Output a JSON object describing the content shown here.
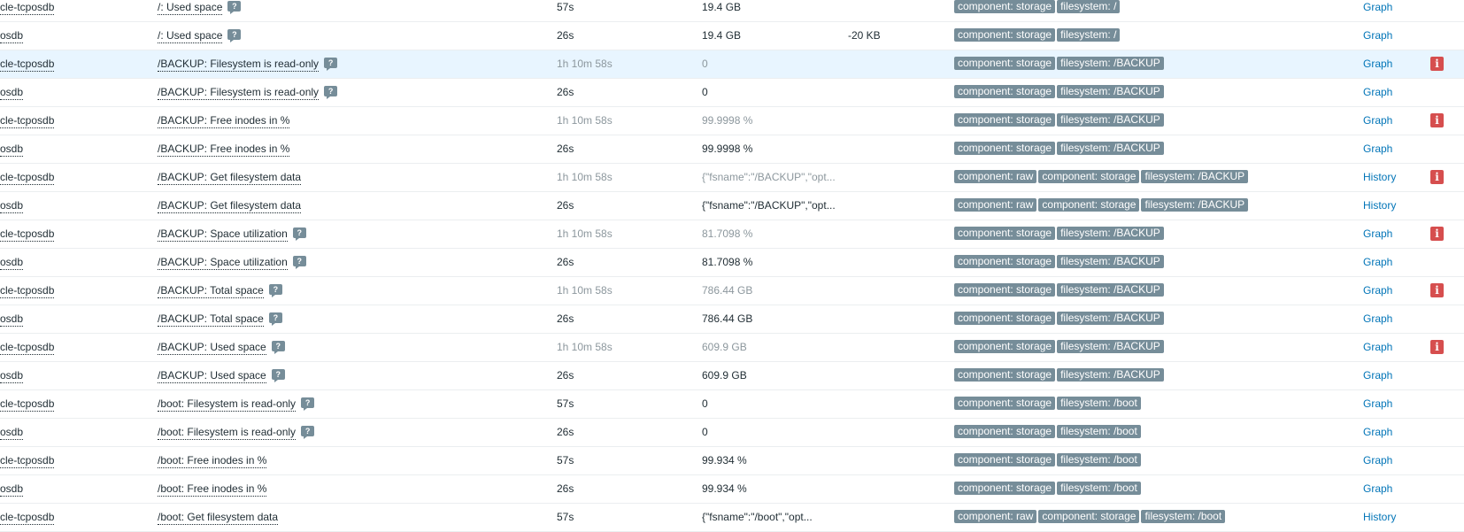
{
  "rows": [
    {
      "host": "cle-tcposdb",
      "name": "/: Used space",
      "hint": true,
      "last": "57s",
      "value": "19.4 GB",
      "change": "",
      "tags": [
        "component: storage",
        "filesystem: /"
      ],
      "link": "Graph",
      "info": false,
      "dim": false,
      "highlight": false
    },
    {
      "host": "osdb",
      "name": "/: Used space",
      "hint": true,
      "last": "26s",
      "value": "19.4 GB",
      "change": "-20 KB",
      "tags": [
        "component: storage",
        "filesystem: /"
      ],
      "link": "Graph",
      "info": false,
      "dim": false,
      "highlight": false
    },
    {
      "host": "cle-tcposdb",
      "name": "/BACKUP: Filesystem is read-only",
      "hint": true,
      "last": "1h 10m 58s",
      "value": "0",
      "change": "",
      "tags": [
        "component: storage",
        "filesystem: /BACKUP"
      ],
      "link": "Graph",
      "info": true,
      "dim": true,
      "highlight": true
    },
    {
      "host": "osdb",
      "name": "/BACKUP: Filesystem is read-only",
      "hint": true,
      "last": "26s",
      "value": "0",
      "change": "",
      "tags": [
        "component: storage",
        "filesystem: /BACKUP"
      ],
      "link": "Graph",
      "info": false,
      "dim": false,
      "highlight": false
    },
    {
      "host": "cle-tcposdb",
      "name": "/BACKUP: Free inodes in %",
      "hint": false,
      "last": "1h 10m 58s",
      "value": "99.9998 %",
      "change": "",
      "tags": [
        "component: storage",
        "filesystem: /BACKUP"
      ],
      "link": "Graph",
      "info": true,
      "dim": true,
      "highlight": false
    },
    {
      "host": "osdb",
      "name": "/BACKUP: Free inodes in %",
      "hint": false,
      "last": "26s",
      "value": "99.9998 %",
      "change": "",
      "tags": [
        "component: storage",
        "filesystem: /BACKUP"
      ],
      "link": "Graph",
      "info": false,
      "dim": false,
      "highlight": false
    },
    {
      "host": "cle-tcposdb",
      "name": "/BACKUP: Get filesystem data",
      "hint": false,
      "last": "1h 10m 58s",
      "value": "{\"fsname\":\"/BACKUP\",\"opt...",
      "change": "",
      "tags": [
        "component: raw",
        "component: storage",
        "filesystem: /BACKUP"
      ],
      "link": "History",
      "info": true,
      "dim": true,
      "highlight": false
    },
    {
      "host": "osdb",
      "name": "/BACKUP: Get filesystem data",
      "hint": false,
      "last": "26s",
      "value": "{\"fsname\":\"/BACKUP\",\"opt...",
      "change": "",
      "tags": [
        "component: raw",
        "component: storage",
        "filesystem: /BACKUP"
      ],
      "link": "History",
      "info": false,
      "dim": false,
      "highlight": false
    },
    {
      "host": "cle-tcposdb",
      "name": "/BACKUP: Space utilization",
      "hint": true,
      "last": "1h 10m 58s",
      "value": "81.7098 %",
      "change": "",
      "tags": [
        "component: storage",
        "filesystem: /BACKUP"
      ],
      "link": "Graph",
      "info": true,
      "dim": true,
      "highlight": false
    },
    {
      "host": "osdb",
      "name": "/BACKUP: Space utilization",
      "hint": true,
      "last": "26s",
      "value": "81.7098 %",
      "change": "",
      "tags": [
        "component: storage",
        "filesystem: /BACKUP"
      ],
      "link": "Graph",
      "info": false,
      "dim": false,
      "highlight": false
    },
    {
      "host": "cle-tcposdb",
      "name": "/BACKUP: Total space",
      "hint": true,
      "last": "1h 10m 58s",
      "value": "786.44 GB",
      "change": "",
      "tags": [
        "component: storage",
        "filesystem: /BACKUP"
      ],
      "link": "Graph",
      "info": true,
      "dim": true,
      "highlight": false
    },
    {
      "host": "osdb",
      "name": "/BACKUP: Total space",
      "hint": true,
      "last": "26s",
      "value": "786.44 GB",
      "change": "",
      "tags": [
        "component: storage",
        "filesystem: /BACKUP"
      ],
      "link": "Graph",
      "info": false,
      "dim": false,
      "highlight": false
    },
    {
      "host": "cle-tcposdb",
      "name": "/BACKUP: Used space",
      "hint": true,
      "last": "1h 10m 58s",
      "value": "609.9 GB",
      "change": "",
      "tags": [
        "component: storage",
        "filesystem: /BACKUP"
      ],
      "link": "Graph",
      "info": true,
      "dim": true,
      "highlight": false
    },
    {
      "host": "osdb",
      "name": "/BACKUP: Used space",
      "hint": true,
      "last": "26s",
      "value": "609.9 GB",
      "change": "",
      "tags": [
        "component: storage",
        "filesystem: /BACKUP"
      ],
      "link": "Graph",
      "info": false,
      "dim": false,
      "highlight": false
    },
    {
      "host": "cle-tcposdb",
      "name": "/boot: Filesystem is read-only",
      "hint": true,
      "last": "57s",
      "value": "0",
      "change": "",
      "tags": [
        "component: storage",
        "filesystem: /boot"
      ],
      "link": "Graph",
      "info": false,
      "dim": false,
      "highlight": false
    },
    {
      "host": "osdb",
      "name": "/boot: Filesystem is read-only",
      "hint": true,
      "last": "26s",
      "value": "0",
      "change": "",
      "tags": [
        "component: storage",
        "filesystem: /boot"
      ],
      "link": "Graph",
      "info": false,
      "dim": false,
      "highlight": false
    },
    {
      "host": "cle-tcposdb",
      "name": "/boot: Free inodes in %",
      "hint": false,
      "last": "57s",
      "value": "99.934 %",
      "change": "",
      "tags": [
        "component: storage",
        "filesystem: /boot"
      ],
      "link": "Graph",
      "info": false,
      "dim": false,
      "highlight": false
    },
    {
      "host": "osdb",
      "name": "/boot: Free inodes in %",
      "hint": false,
      "last": "26s",
      "value": "99.934 %",
      "change": "",
      "tags": [
        "component: storage",
        "filesystem: /boot"
      ],
      "link": "Graph",
      "info": false,
      "dim": false,
      "highlight": false
    },
    {
      "host": "cle-tcposdb",
      "name": "/boot: Get filesystem data",
      "hint": false,
      "last": "57s",
      "value": "{\"fsname\":\"/boot\",\"opt...",
      "change": "",
      "tags": [
        "component: raw",
        "component: storage",
        "filesystem: /boot"
      ],
      "link": "History",
      "info": false,
      "dim": false,
      "highlight": false
    }
  ],
  "icons": {
    "hint": "?",
    "info": "i"
  },
  "colors": {
    "tag_bg": "#768d99",
    "link": "#0275b8",
    "info_bg": "#d64e4e",
    "highlight_row": "#e8f5ff"
  }
}
